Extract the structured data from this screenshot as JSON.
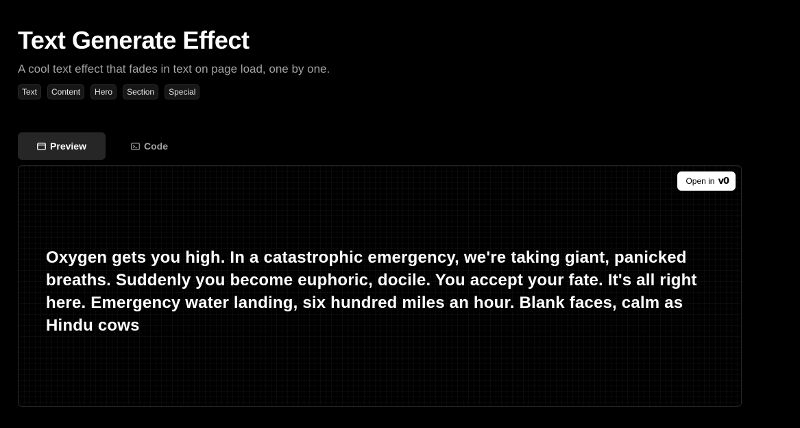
{
  "header": {
    "title": "Text Generate Effect",
    "subtitle": "A cool text effect that fades in text on page load, one by one."
  },
  "tags": [
    "Text",
    "Content",
    "Hero",
    "Section",
    "Special"
  ],
  "tabs": {
    "preview_label": "Preview",
    "code_label": "Code",
    "active": "Preview"
  },
  "preview": {
    "open_in_label": "Open in",
    "open_in_logo": "v0",
    "text": "Oxygen gets you high. In a catastrophic emergency, we're taking giant, panicked breaths. Suddenly you become euphoric, docile. You accept your fate. It's all right here. Emergency water landing, six hundred miles an hour. Blank faces, calm as Hindu cows"
  },
  "colors": {
    "background": "#000000",
    "text": "#ffffff",
    "muted": "#a3a3a3",
    "tab_active_bg": "#262626",
    "border": "#262626"
  }
}
